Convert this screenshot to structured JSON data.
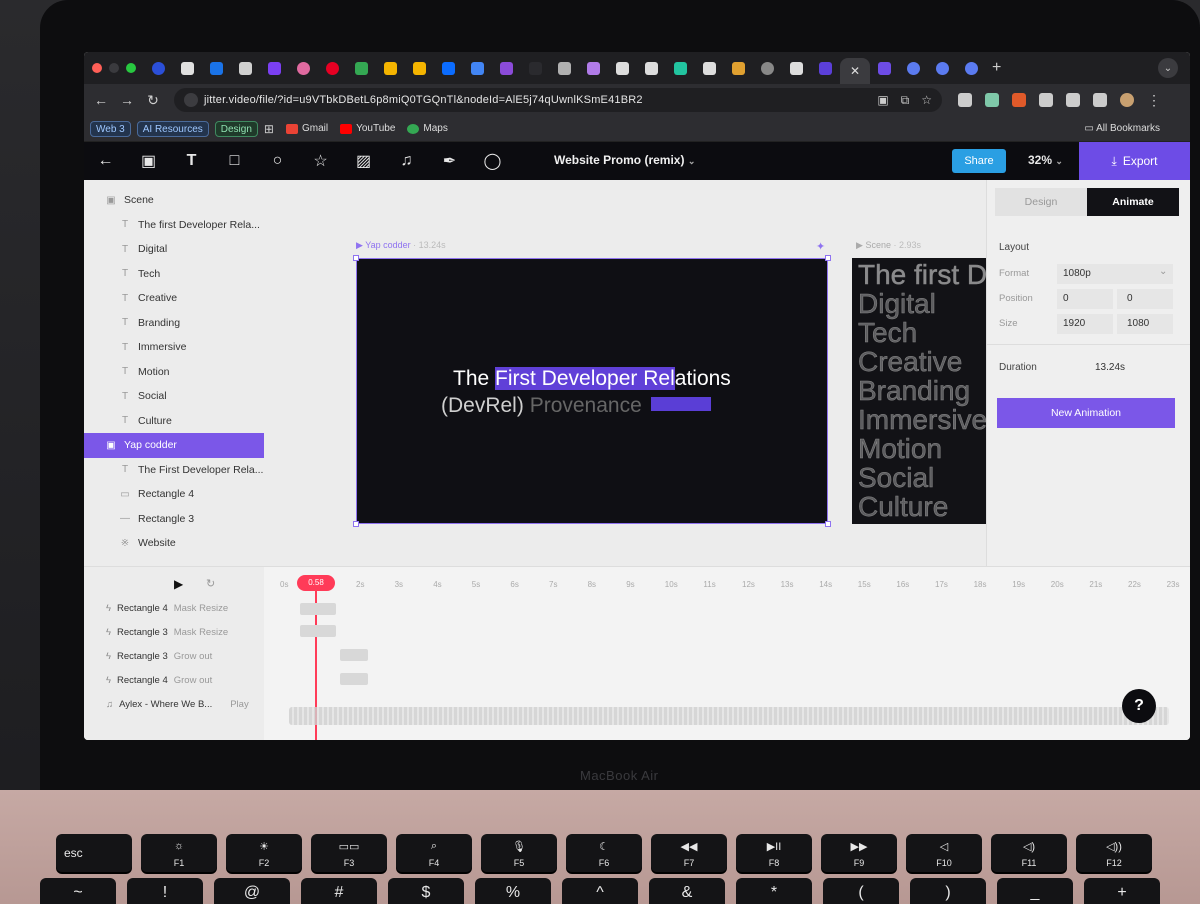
{
  "browser": {
    "tab_close": "✕",
    "new_tab": "+",
    "tab_dropdown": "⌄",
    "url": "jitter.video/file/?id=u9VTbkDBetL6p8miQ0TGQnTl&nodeId=AlE5j74qUwnlKSmE41BR2",
    "bookmarks": {
      "chips": [
        "Web 3",
        "AI Resources",
        "Design"
      ],
      "links": [
        "Gmail",
        "YouTube",
        "Maps"
      ],
      "all": "All Bookmarks"
    }
  },
  "toolbar": {
    "doc_title": "Website Promo (remix)",
    "share_label": "Share",
    "zoom": "32%",
    "export_label": "Export"
  },
  "layers": [
    {
      "icon": "scene-icon",
      "label": "Scene",
      "indent": 0
    },
    {
      "icon": "text-icon",
      "label": "The first Developer Rela...",
      "indent": 1
    },
    {
      "icon": "text-icon",
      "label": "Digital",
      "indent": 1
    },
    {
      "icon": "text-icon",
      "label": "Tech",
      "indent": 1
    },
    {
      "icon": "text-icon",
      "label": "Creative",
      "indent": 1
    },
    {
      "icon": "text-icon",
      "label": "Branding",
      "indent": 1
    },
    {
      "icon": "text-icon",
      "label": "Immersive",
      "indent": 1
    },
    {
      "icon": "text-icon",
      "label": "Motion",
      "indent": 1
    },
    {
      "icon": "text-icon",
      "label": "Social",
      "indent": 1
    },
    {
      "icon": "text-icon",
      "label": "Culture",
      "indent": 1
    },
    {
      "icon": "frame-icon",
      "label": "Yap codder",
      "indent": 0,
      "selected": true
    },
    {
      "icon": "text-icon",
      "label": "The First Developer Rela...",
      "indent": 1
    },
    {
      "icon": "rectangle-icon",
      "label": "Rectangle 4",
      "indent": 1
    },
    {
      "icon": "line-icon",
      "label": "Rectangle 3",
      "indent": 1
    },
    {
      "icon": "website-icon",
      "label": "Website",
      "indent": 1
    }
  ],
  "canvas": {
    "frame_label": "Yap codder",
    "frame_duration": "· 13.24s",
    "headline_pre": "The ",
    "headline_sel": "First Developer Rel",
    "headline_post": "ations",
    "subline_main": "(DevRel) ",
    "subline_dim": "Provenance",
    "scene_label": "Scene",
    "scene_duration": "· 2.93s",
    "scene_words": [
      "The first D",
      "Digital",
      "Tech",
      "Creative",
      "Branding",
      "Immersive",
      "Motion",
      "Social",
      "Culture"
    ]
  },
  "right_panel": {
    "tab_design": "Design",
    "tab_animate": "Animate",
    "layout_title": "Layout",
    "format_label": "Format",
    "format_value": "1080p",
    "position_label": "Position",
    "position_x": "0",
    "position_y": "0",
    "size_label": "Size",
    "size_w": "1920",
    "size_h": "1080",
    "duration_label": "Duration",
    "duration_value": "13.24s",
    "new_animation": "New Animation"
  },
  "timeline": {
    "playhead": "0.58",
    "ticks": [
      "0s",
      "2s",
      "3s",
      "4s",
      "5s",
      "6s",
      "7s",
      "8s",
      "9s",
      "10s",
      "11s",
      "12s",
      "13s",
      "14s",
      "15s",
      "16s",
      "17s",
      "18s",
      "19s",
      "20s",
      "21s",
      "22s",
      "23s"
    ],
    "tracks": [
      {
        "name": "Rectangle 4",
        "action": "Mask Resize"
      },
      {
        "name": "Rectangle 3",
        "action": "Mask Resize"
      },
      {
        "name": "Rectangle 3",
        "action": "Grow out"
      },
      {
        "name": "Rectangle 4",
        "action": "Grow out"
      },
      {
        "name": "Aylex - Where We B...",
        "action": "Play"
      }
    ],
    "help": "?"
  },
  "laptop": {
    "label": "MacBook Air",
    "fkeys": [
      {
        "glyph": "esc",
        "fn": ""
      },
      {
        "glyph": "☼",
        "fn": "F1"
      },
      {
        "glyph": "☀",
        "fn": "F2"
      },
      {
        "glyph": "▭▭",
        "fn": "F3"
      },
      {
        "glyph": "⌕",
        "fn": "F4"
      },
      {
        "glyph": "🎙",
        "fn": "F5"
      },
      {
        "glyph": "☾",
        "fn": "F6"
      },
      {
        "glyph": "◀◀",
        "fn": "F7"
      },
      {
        "glyph": "▶II",
        "fn": "F8"
      },
      {
        "glyph": "▶▶",
        "fn": "F9"
      },
      {
        "glyph": "◁",
        "fn": "F10"
      },
      {
        "glyph": "◁)",
        "fn": "F11"
      },
      {
        "glyph": "◁))",
        "fn": "F12"
      }
    ],
    "row2": [
      "~",
      "!",
      "@",
      "#",
      "$",
      "%",
      "^",
      "&",
      "*",
      "(",
      ")",
      "_",
      "+"
    ]
  },
  "colors": {
    "accent": "#7b57e8",
    "share": "#2a9fe3",
    "playhead": "#ff3b58"
  }
}
